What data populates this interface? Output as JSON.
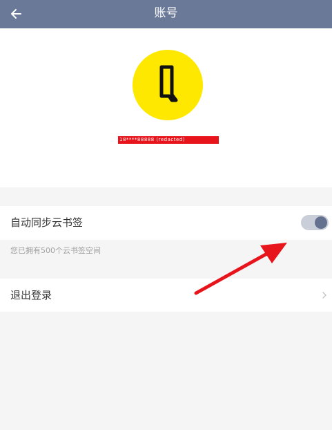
{
  "header": {
    "title": "账号",
    "back_icon": "arrow-left-icon"
  },
  "profile": {
    "avatar_icon": "bookmark-logo-icon",
    "avatar_color": "#ffe800",
    "account_id": "18****88888 (redacted)"
  },
  "settings": {
    "sync_label": "自动同步云书签",
    "sync_enabled": true,
    "sync_hint": "您已拥有500个云书签空间",
    "logout_label": "退出登录"
  },
  "colors": {
    "header_bg": "#6b7998",
    "toggle_track": "#c9ced9",
    "toggle_knob": "#64728f",
    "annotation_arrow": "#e8141c"
  }
}
